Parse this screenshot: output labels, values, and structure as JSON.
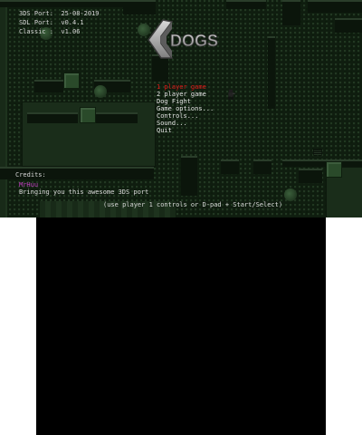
{
  "version_info": {
    "ds_port": "3DS Port:  25-08-2019",
    "sdl_port": "SDL Port:  v0.4.1",
    "classic": "Classic :  v1.06"
  },
  "logo": {
    "text": "DOGS",
    "initial": "C"
  },
  "menu": {
    "items": [
      {
        "label": "1 player game",
        "selected": true
      },
      {
        "label": "2 player game",
        "selected": false
      },
      {
        "label": "Dog Fight",
        "selected": false
      },
      {
        "label": "Game options...",
        "selected": false
      },
      {
        "label": "Controls...",
        "selected": false
      },
      {
        "label": "Sound...",
        "selected": false
      },
      {
        "label": "Quit",
        "selected": false
      }
    ]
  },
  "credits": {
    "heading": "Credits:",
    "name": "MrHuu",
    "message": "Bringing you this awesome 3DS port"
  },
  "hint": "(use player 1 controls or D-pad + Start/Select)",
  "colors": {
    "selected": "#e01818",
    "text": "#e4e4e4",
    "credit_name": "#c040c0"
  }
}
